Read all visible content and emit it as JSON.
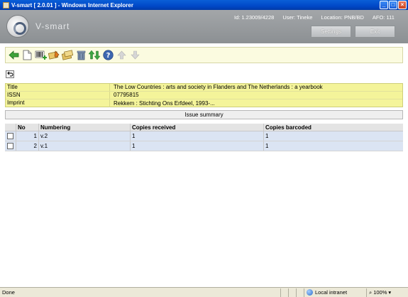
{
  "window": {
    "title": "V-smart [ 2.0.01 ] - Windows Internet Explorer"
  },
  "header": {
    "brand": "V-smart",
    "id_text": "Id: 1.23009/4228",
    "user_text": "User: Tineke",
    "location_text": "Location: PNB/BD",
    "afo_text": "AFO: 111",
    "settings_label": "Settings",
    "exit_label": "Exit"
  },
  "toolbar": {
    "icons": [
      "back-arrow-icon",
      "new-document-icon",
      "barcode-add-icon",
      "edit-copies-icon",
      "copy-records-icon",
      "delete-trash-icon",
      "sort-updown-icon",
      "help-icon",
      "move-up-icon",
      "move-down-icon"
    ]
  },
  "info": {
    "rows": [
      {
        "label": "Title",
        "value": "The Low Countries : arts and society in Flanders and The Netherlands : a yearbook"
      },
      {
        "label": "ISSN",
        "value": "07795815"
      },
      {
        "label": "Imprint",
        "value": "Rekkem : Stichting Ons Erfdeel, 1993-..."
      }
    ]
  },
  "summary": {
    "title": "Issue summary",
    "columns": {
      "no": "No",
      "numbering": "Numbering",
      "received": "Copies received",
      "barcoded": "Copies barcoded"
    },
    "rows": [
      {
        "no": "1",
        "numbering": "v.2",
        "received": "1",
        "barcoded": "1"
      },
      {
        "no": "2",
        "numbering": "v.1",
        "received": "1",
        "barcoded": "1"
      }
    ]
  },
  "status": {
    "left": "Done",
    "zone": "Local intranet",
    "zoom": "100%"
  },
  "colors": {
    "toolbar_bg": "#fbfbe0",
    "info_bg": "#f4f49a",
    "header_bg": "#9a9da0"
  }
}
